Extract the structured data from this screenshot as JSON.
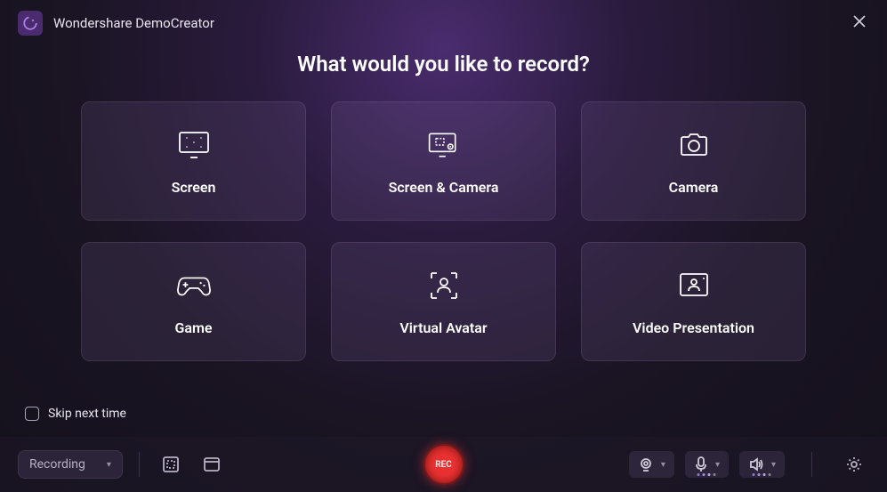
{
  "app": {
    "title": "Wondershare DemoCreator"
  },
  "heading": "What would you like to record?",
  "cards": [
    {
      "label": "Screen"
    },
    {
      "label": "Screen & Camera"
    },
    {
      "label": "Camera"
    },
    {
      "label": "Game"
    },
    {
      "label": "Virtual Avatar"
    },
    {
      "label": "Video Presentation"
    }
  ],
  "skip": {
    "label": "Skip next time",
    "checked": false
  },
  "bottomBar": {
    "modeDropdown": {
      "label": "Recording"
    },
    "recLabel": "REC"
  }
}
